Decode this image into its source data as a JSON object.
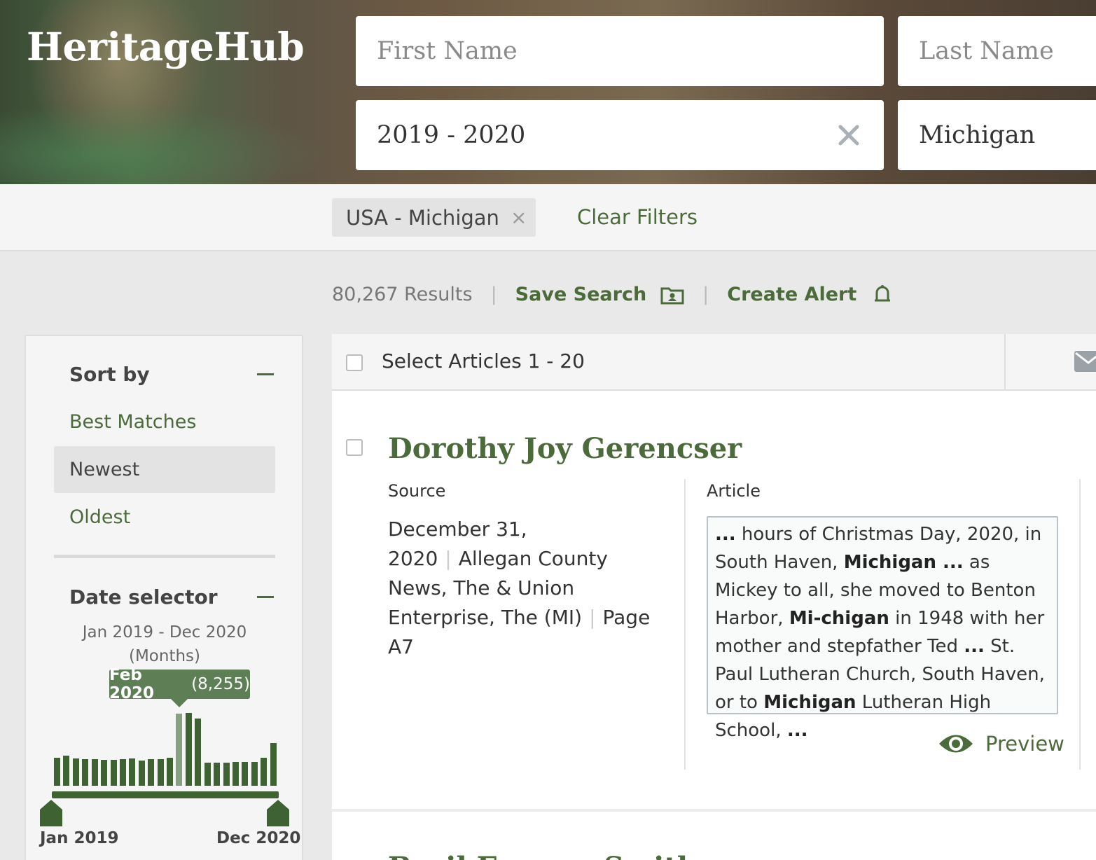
{
  "app": {
    "logo": "HeritageHub"
  },
  "search": {
    "first_name_placeholder": "First Name",
    "last_name_placeholder": "Last Name",
    "date_value": "2019 - 2020",
    "place_value": "Michigan"
  },
  "filters": {
    "chip_label": "USA - Michigan",
    "chip_close": "×",
    "clear_label": "Clear Filters"
  },
  "results": {
    "count": "80,267 Results",
    "sep": "|",
    "save_label": "Save Search",
    "alert_label": "Create Alert"
  },
  "sidebar": {
    "sort_title": "Sort by",
    "sort_options": [
      "Best Matches",
      "Newest",
      "Oldest"
    ],
    "active_sort": "Newest",
    "date_title": "Date selector",
    "date_range_line1": "Jan 2019 - Dec 2020",
    "date_range_line2": "(Months)",
    "tooltip_month": "Feb 2020",
    "tooltip_count": "(8,255)",
    "axis_start": "Jan 2019",
    "axis_end": "Dec 2020"
  },
  "chart_data": {
    "type": "bar",
    "categories": [
      "Jan 2019",
      "Feb 2019",
      "Mar 2019",
      "Apr 2019",
      "May 2019",
      "Jun 2019",
      "Jul 2019",
      "Aug 2019",
      "Sep 2019",
      "Oct 2019",
      "Nov 2019",
      "Dec 2019",
      "Jan 2020",
      "Feb 2020",
      "Mar 2020",
      "Apr 2020",
      "May 2020",
      "Jun 2020",
      "Jul 2020",
      "Aug 2020",
      "Sep 2020",
      "Oct 2020",
      "Nov 2020",
      "Dec 2020"
    ],
    "values": [
      3200,
      3400,
      3100,
      3000,
      3000,
      2950,
      2950,
      3000,
      3100,
      2900,
      3000,
      3000,
      3200,
      8255,
      8300,
      7700,
      2600,
      2600,
      2600,
      2700,
      2700,
      2700,
      3200,
      4900
    ],
    "highlight": "Feb 2020",
    "ylim": [
      0,
      8300
    ]
  },
  "articles": {
    "select_label": "Select Articles 1 - 20",
    "first": {
      "title": "Dorothy Joy Gerencser",
      "source_label": "Source",
      "article_label": "Article",
      "date": "December 31, 2020",
      "publication": "Allegan County News, The & Union Enterprise, The (MI)",
      "page": "Page A7",
      "snippet_html": "<b>...</b> hours of Christmas Day, 2020, in South Haven, <b>Michigan ...</b> as Mickey to all, she moved to Benton Harbor, <b>Mi-chigan</b> in 1948 with her mother and stepfather Ted <b>...</b> St. Paul Lutheran Church, South Haven, or to <b>Michigan</b> Lutheran High School, <b>...</b>",
      "preview_label": "Preview"
    },
    "second_title": "Basil Eugene Smith"
  },
  "colors": {
    "accent": "#4b6b3a",
    "bar": "#3e6232",
    "bar_highlight": "#8aa082"
  }
}
